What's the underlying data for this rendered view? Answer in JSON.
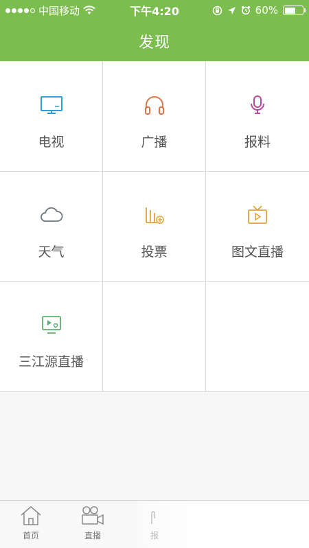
{
  "status_bar": {
    "carrier": "中国移动",
    "time": "下午4:20",
    "battery": "60%",
    "battery_level": 0.6
  },
  "header": {
    "title": "发现"
  },
  "grid": {
    "items": [
      {
        "label": "电视",
        "icon": "tv-icon",
        "color": "#2aa0d4"
      },
      {
        "label": "广播",
        "icon": "headphones-icon",
        "color": "#d9774c"
      },
      {
        "label": "报料",
        "icon": "microphone-icon",
        "color": "#b7489d"
      },
      {
        "label": "天气",
        "icon": "cloud-icon",
        "color": "#6d7480"
      },
      {
        "label": "投票",
        "icon": "bar-chart-icon",
        "color": "#e0a43a"
      },
      {
        "label": "图文直播",
        "icon": "tv-play-icon",
        "color": "#e0a43a"
      },
      {
        "label": "三江源直播",
        "icon": "video-heart-icon",
        "color": "#5bb06f"
      }
    ]
  },
  "tab_bar": {
    "tabs": [
      {
        "label": "首页",
        "icon": "home-icon"
      },
      {
        "label": "直播",
        "icon": "video-camera-icon"
      },
      {
        "label": "报",
        "icon": "hand-icon"
      }
    ]
  }
}
